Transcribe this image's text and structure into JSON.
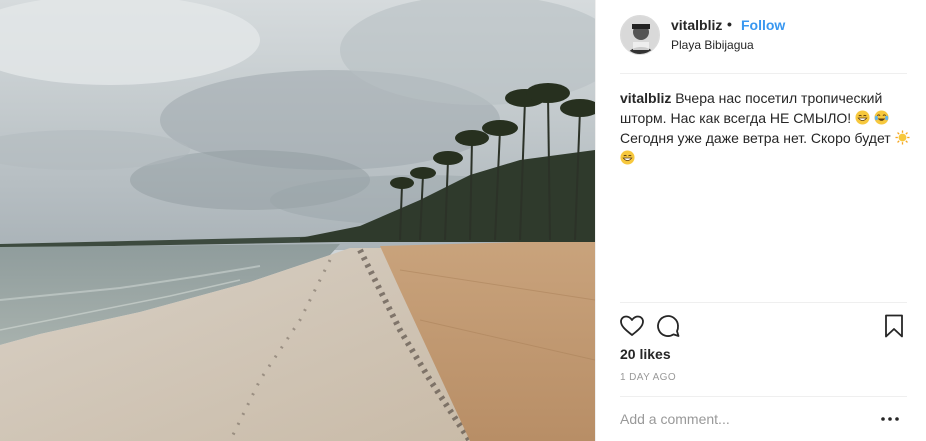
{
  "post": {
    "username": "vitalbliz",
    "separator": "•",
    "follow_label": "Follow",
    "location": "Playa Bibijagua",
    "caption_user": "vitalbliz",
    "caption_line1": "Вчера нас посетил тропический шторм. Нас как всегда НЕ СМЫЛО!",
    "caption_line2": "Сегодня уже даже ветра нет. Скоро будет",
    "likes": "20 likes",
    "time": "1 DAY AGO",
    "comment_placeholder": "Add a comment..."
  },
  "icons": {
    "like": "heart-icon",
    "comment": "comment-bubble-icon",
    "save": "bookmark-icon",
    "more": "more-options-icon",
    "emoji_grin": "grinning-face-emoji",
    "emoji_tears": "tears-of-joy-emoji",
    "emoji_sun": "sun-emoji"
  },
  "colors": {
    "link_blue": "#3897f0",
    "text": "#262626",
    "muted": "#999999",
    "divider": "#efefef"
  }
}
